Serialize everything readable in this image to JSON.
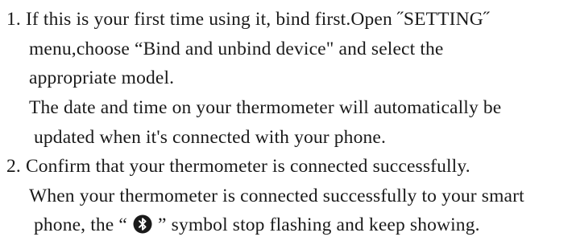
{
  "instructions": {
    "step1": {
      "line1": "1. If this is your first time using it, bind first.Open ˝SETTING˝",
      "line2": "menu,choose “Bind and unbind device\" and select the",
      "line3": "appropriate model.",
      "line4": "The date and time on your thermometer will automatically be",
      "line5": "updated when it's connected with your phone."
    },
    "step2": {
      "line1": "2. Confirm that your thermometer is connected successfully.",
      "line2": "When your thermometer is connected successfully to your smart",
      "line3_before_icon": "phone,  the “ ",
      "icon": "bluetooth-icon",
      "line3_after_icon": " ” symbol stop flashing and keep showing."
    }
  }
}
